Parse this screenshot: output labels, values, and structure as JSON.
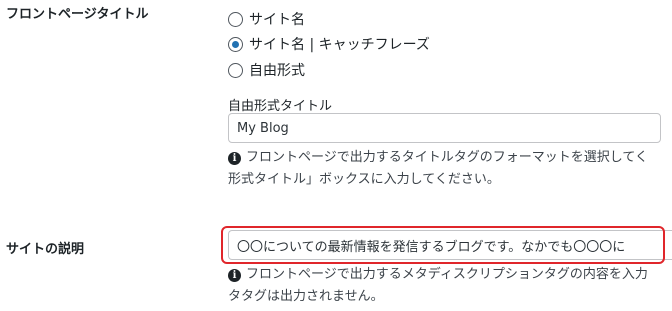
{
  "front_page_title": {
    "label": "フロントページタイトル",
    "options": [
      {
        "label": "サイト名",
        "checked": false
      },
      {
        "label": "サイト名 | キャッチフレーズ",
        "checked": true
      },
      {
        "label": "自由形式",
        "checked": false
      }
    ],
    "free_title_label": "自由形式タイトル",
    "free_title_value": "My Blog",
    "help_line1": "フロントページで出力するタイトルタグのフォーマットを選択してく",
    "help_line2": "形式タイトル」ボックスに入力してください。"
  },
  "site_description": {
    "label": "サイトの説明",
    "value": "〇〇についての最新情報を発信するブログです。なかでも〇〇〇に",
    "help_line1": "フロントページで出力するメタディスクリプションタグの内容を入力",
    "help_line2": "タタグは出力されません。"
  },
  "colors": {
    "accent": "#2271b1",
    "highlight": "#e0262b"
  }
}
